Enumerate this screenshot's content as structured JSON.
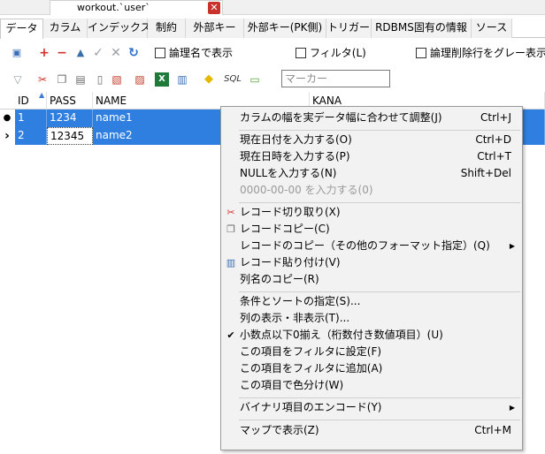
{
  "document_tab": {
    "title": "workout.`user`",
    "close_glyph": "✕"
  },
  "sub_tabs": [
    {
      "label": "データ",
      "active": true
    },
    {
      "label": "カラム"
    },
    {
      "label": "インデックス"
    },
    {
      "label": "制約"
    },
    {
      "label": "外部キー"
    },
    {
      "label": "外部キー(PK側)"
    },
    {
      "label": "トリガー"
    },
    {
      "label": "RDBMS固有の情報"
    },
    {
      "label": "ソース"
    }
  ],
  "toolbar": {
    "logical_name_label": "論理名で表示",
    "filter_label": "フィルタ(L)",
    "logical_delete_label": "論理削除行をグレー表示",
    "sql_label": "SQL",
    "marker_placeholder": "マーカー"
  },
  "grid": {
    "columns": [
      "ID",
      "PASS",
      "NAME",
      "KANA"
    ],
    "rows": [
      {
        "marker": "●",
        "id": "1",
        "pass": "1234",
        "name": "name1"
      },
      {
        "marker": "›",
        "id": "2",
        "pass": "12345",
        "name": "name2"
      }
    ]
  },
  "context_menu": {
    "items": [
      {
        "label": "カラムの幅を実データ幅に合わせて調整(J)",
        "shortcut": "Ctrl+J"
      },
      {
        "separator": true
      },
      {
        "label": "現在日付を入力する(O)",
        "shortcut": "Ctrl+D"
      },
      {
        "label": "現在日時を入力する(P)",
        "shortcut": "Ctrl+T"
      },
      {
        "label": "NULLを入力する(N)",
        "shortcut": "Shift+Del"
      },
      {
        "label": "0000-00-00 を入力する(0)",
        "disabled": true
      },
      {
        "separator": true
      },
      {
        "label": "レコード切り取り(X)",
        "icon": "scissors-icon"
      },
      {
        "label": "レコードコピー(C)",
        "icon": "copy-icon"
      },
      {
        "label": "レコードのコピー（その他のフォーマット指定）(Q)",
        "submenu": true
      },
      {
        "label": "レコード貼り付け(V)",
        "icon": "paste-icon"
      },
      {
        "label": "列名のコピー(R)"
      },
      {
        "separator": true
      },
      {
        "label": "条件とソートの指定(S)..."
      },
      {
        "label": "列の表示・非表示(T)..."
      },
      {
        "label": "小数点以下0揃え（桁数付き数値項目）(U)",
        "checked": true
      },
      {
        "label": "この項目をフィルタに設定(F)"
      },
      {
        "label": "この項目をフィルタに追加(A)"
      },
      {
        "label": "この項目で色分け(W)"
      },
      {
        "separator": true
      },
      {
        "label": "バイナリ項目のエンコード(Y)",
        "submenu": true
      },
      {
        "separator": true
      },
      {
        "label": "マップで表示(Z)",
        "shortcut": "Ctrl+M"
      }
    ]
  },
  "colors": {
    "selection": "#2f7fe0",
    "menu_bg": "#f2f2f2",
    "close": "#c8322b"
  }
}
